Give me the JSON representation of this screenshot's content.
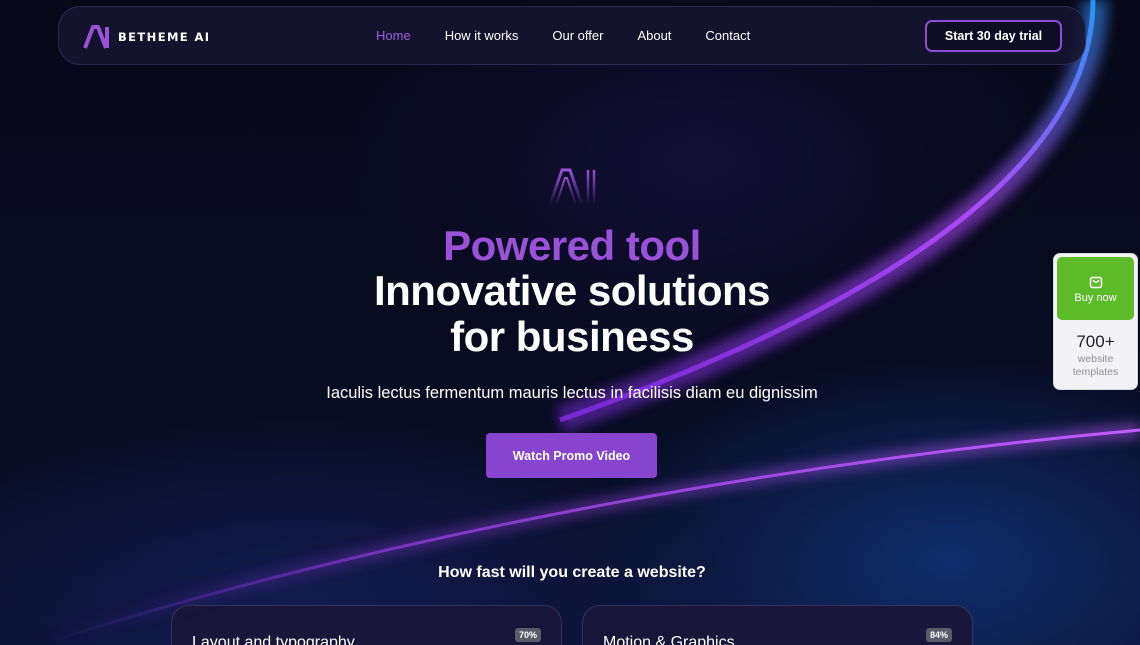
{
  "header": {
    "brand": "BETHEME AI",
    "menu": [
      {
        "label": "Home",
        "active": true
      },
      {
        "label": "How it works",
        "active": false
      },
      {
        "label": "Our offer",
        "active": false
      },
      {
        "label": "About",
        "active": false
      },
      {
        "label": "Contact",
        "active": false
      }
    ],
    "cta_label": "Start 30 day trial"
  },
  "hero": {
    "kicker": "Powered tool",
    "title_line1": "Innovative solutions",
    "title_line2": "for business",
    "subtitle": "Iaculis lectus fermentum mauris lectus in facilisis diam eu dignissim",
    "button_label": "Watch Promo Video"
  },
  "side_widget": {
    "buy_label": "Buy now",
    "templates_count": "700+",
    "templates_line1": "website",
    "templates_line2": "templates"
  },
  "section": {
    "title": "How fast will you create a website?",
    "cards": [
      {
        "title": "Layout and typography",
        "badge": "70%"
      },
      {
        "title": "Motion & Graphics",
        "badge": "84%"
      }
    ]
  },
  "colors": {
    "accent": "#8745cf",
    "active_link": "#9a5ce0",
    "buy_green": "#5dbb2a",
    "background": "#060818"
  },
  "icons": {
    "logo": "ai-logo-icon",
    "hero_mark": "ai-outline-icon",
    "buy": "shopping-bag-icon"
  }
}
